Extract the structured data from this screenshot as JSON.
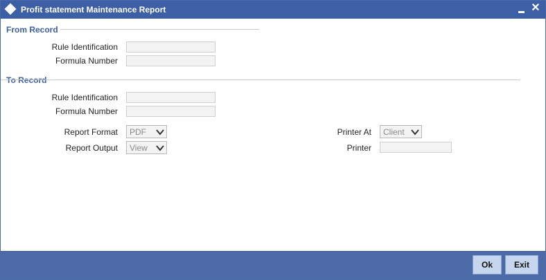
{
  "window": {
    "title": "Profit statement Maintenance Report"
  },
  "from_record": {
    "heading": "From Record",
    "rule_identification_label": "Rule Identification",
    "rule_identification_value": "",
    "formula_number_label": "Formula Number",
    "formula_number_value": ""
  },
  "to_record": {
    "heading": "To Record",
    "rule_identification_label": "Rule Identification",
    "rule_identification_value": "",
    "formula_number_label": "Formula Number",
    "formula_number_value": ""
  },
  "report": {
    "format_label": "Report Format",
    "format_value": "PDF",
    "output_label": "Report Output",
    "output_value": "View",
    "printer_at_label": "Printer At",
    "printer_at_value": "Client",
    "printer_label": "Printer",
    "printer_value": ""
  },
  "footer": {
    "ok_label": "Ok",
    "exit_label": "Exit"
  },
  "colors": {
    "titlebar": "#3d5fa6",
    "section_heading": "#3d5fa6",
    "footer": "#4c6aa8",
    "button": "#c5d6ee"
  },
  "icons": [
    "diamond-icon",
    "minimize-icon",
    "close-icon",
    "chevron-down-icon"
  ]
}
